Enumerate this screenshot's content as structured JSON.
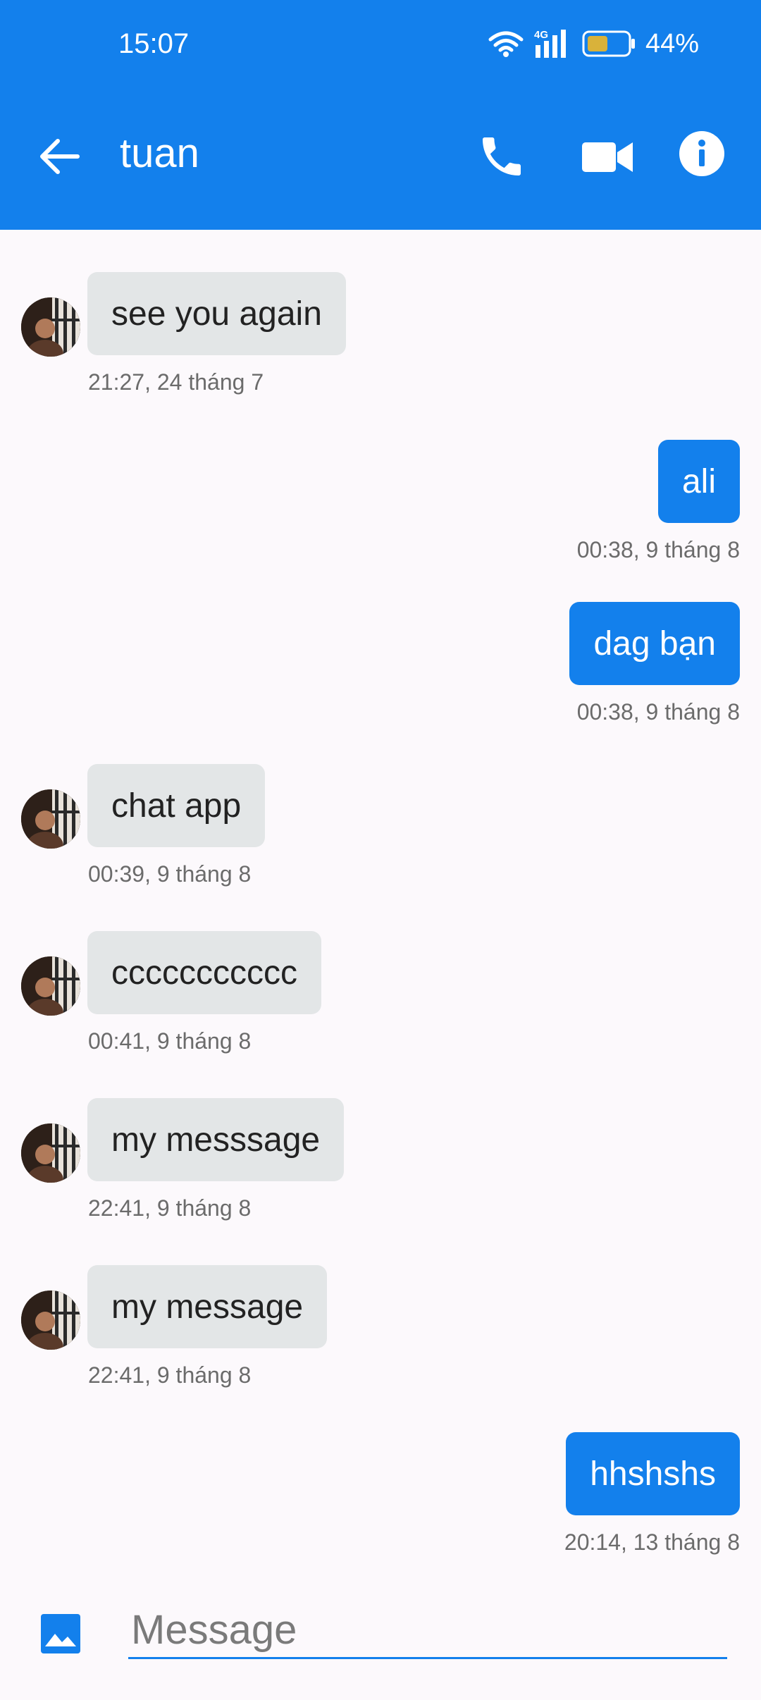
{
  "status_bar": {
    "time": "15:07",
    "network": "4G",
    "battery": "44%"
  },
  "header": {
    "contact_name": "tuan"
  },
  "icons": {
    "back": "arrow-left-icon",
    "call": "phone-icon",
    "video": "video-camera-icon",
    "info": "info-icon",
    "gallery": "image-icon"
  },
  "colors": {
    "primary": "#1380ec",
    "incoming_bubble": "#e3e6e7",
    "background": "#fcf9fc"
  },
  "messages": [
    {
      "direction": "incoming",
      "text": "see you again",
      "time": "21:27, 24 tháng 7"
    },
    {
      "direction": "outgoing",
      "text": "ali",
      "time": "00:38, 9 tháng 8"
    },
    {
      "direction": "outgoing",
      "text": "dag bạn",
      "time": "00:38, 9 tháng 8"
    },
    {
      "direction": "incoming",
      "text": "chat app",
      "time": "00:39, 9 tháng 8"
    },
    {
      "direction": "incoming",
      "text": "ccccccccccc",
      "time": "00:41, 9 tháng 8"
    },
    {
      "direction": "incoming",
      "text": "my messsage",
      "time": "22:41, 9 tháng 8"
    },
    {
      "direction": "incoming",
      "text": "my message",
      "time": "22:41, 9 tháng 8"
    },
    {
      "direction": "outgoing",
      "text": "hhshshs",
      "time": "20:14, 13 tháng 8"
    }
  ],
  "composer": {
    "placeholder": "Message",
    "value": ""
  }
}
